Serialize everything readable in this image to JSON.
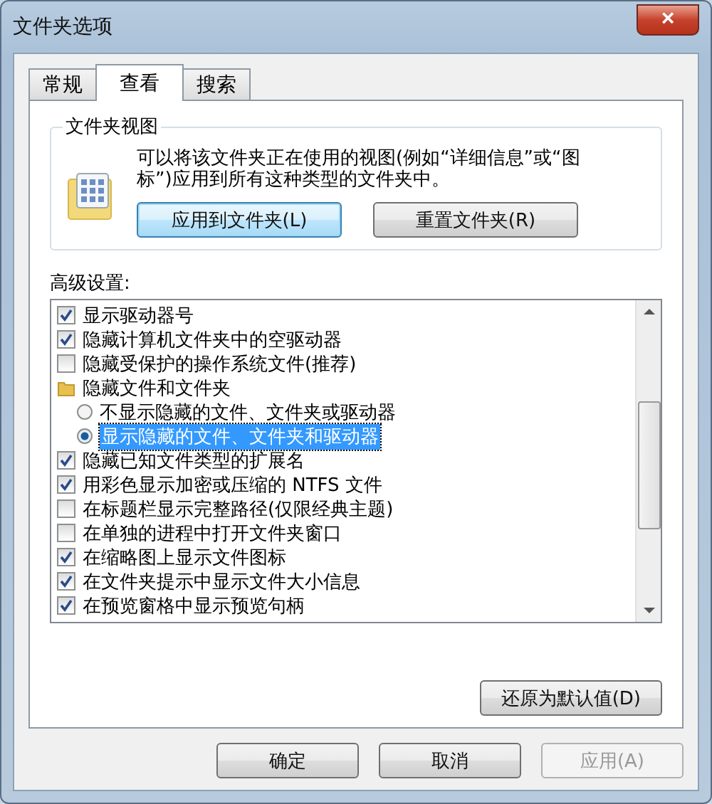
{
  "window": {
    "title": "文件夹选项",
    "close": "×"
  },
  "tabs": [
    {
      "label": "常规",
      "selected": false
    },
    {
      "label": "查看",
      "selected": true
    },
    {
      "label": "搜索",
      "selected": false
    }
  ],
  "folder_views": {
    "title": "文件夹视图",
    "description": "可以将该文件夹正在使用的视图(例如“详细信息”或“图标”)应用到所有这种类型的文件夹中。",
    "buttons": [
      "应用到文件夹(L)",
      "重置文件夹(R)"
    ]
  },
  "advanced": {
    "label": "高级设置:",
    "items": [
      {
        "kind": "checkbox",
        "label": "显示驱动器号",
        "checked": true
      },
      {
        "kind": "checkbox",
        "label": "隐藏计算机文件夹中的空驱动器",
        "checked": true
      },
      {
        "kind": "checkbox",
        "label": "隐藏受保护的操作系统文件(推荐)",
        "checked": false
      },
      {
        "kind": "folder",
        "label": "隐藏文件和文件夹",
        "children": [
          {
            "kind": "radio",
            "label": "不显示隐藏的文件、文件夹或驱动器",
            "selected": false
          },
          {
            "kind": "radio",
            "label": "显示隐藏的文件、文件夹和驱动器",
            "selected": true
          }
        ]
      },
      {
        "kind": "checkbox",
        "label": "隐藏已知文件类型的扩展名",
        "checked": true
      },
      {
        "kind": "checkbox",
        "label": "用彩色显示加密或压缩的 NTFS 文件",
        "checked": true
      },
      {
        "kind": "checkbox",
        "label": "在标题栏显示完整路径(仅限经典主题)",
        "checked": false
      },
      {
        "kind": "checkbox",
        "label": "在单独的进程中打开文件夹窗口",
        "checked": false
      },
      {
        "kind": "checkbox",
        "label": "在缩略图上显示文件图标",
        "checked": true
      },
      {
        "kind": "checkbox",
        "label": "在文件夹提示中显示文件大小信息",
        "checked": true
      },
      {
        "kind": "checkbox",
        "label": "在预览窗格中显示预览句柄",
        "checked": true
      }
    ],
    "restore_button": "还原为默认值(D)"
  },
  "footer_buttons": [
    {
      "label": "确定",
      "disabled": false
    },
    {
      "label": "取消",
      "disabled": false
    },
    {
      "label": "应用(A)",
      "disabled": true
    }
  ]
}
